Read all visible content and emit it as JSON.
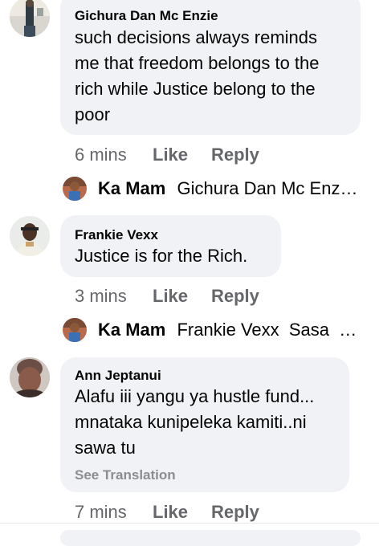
{
  "comments": [
    {
      "author": "Gichura Dan Mc Enzie",
      "text_lines": [
        "such decisions always reminds",
        "me that freedom belongs to the",
        "rich while Justice belong to the",
        "poor"
      ],
      "time": "6 mins",
      "like": "Like",
      "reply": "Reply",
      "reply_preview": {
        "name": "Ka Mam",
        "text": "Gichura Dan Mc Enz…"
      }
    },
    {
      "author": "Frankie Vexx",
      "text_lines": [
        "Justice is for the Rich."
      ],
      "time": "3 mins",
      "like": "Like",
      "reply": "Reply",
      "reply_preview": {
        "name": "Ka Mam",
        "text": "Frankie Vexx  Sasa  …"
      }
    },
    {
      "author": "Ann Jeptanui",
      "text_lines": [
        "Alafu iii yangu ya hustle fund...",
        "mnataka kunipeleka kamiti..ni",
        "sawa tu"
      ],
      "see_translation": "See Translation",
      "time": "7 mins",
      "like": "Like",
      "reply": "Reply"
    }
  ],
  "icons": {
    "avatar_1": "user-photo-avatar",
    "avatar_2": "user-photo-avatar",
    "avatar_3": "user-photo-avatar",
    "reply_avatar": "user-photo-avatar"
  },
  "colors": {
    "bubble_bg": "#f0f2f5",
    "meta_text": "#65676b",
    "primary_text": "#050505"
  }
}
